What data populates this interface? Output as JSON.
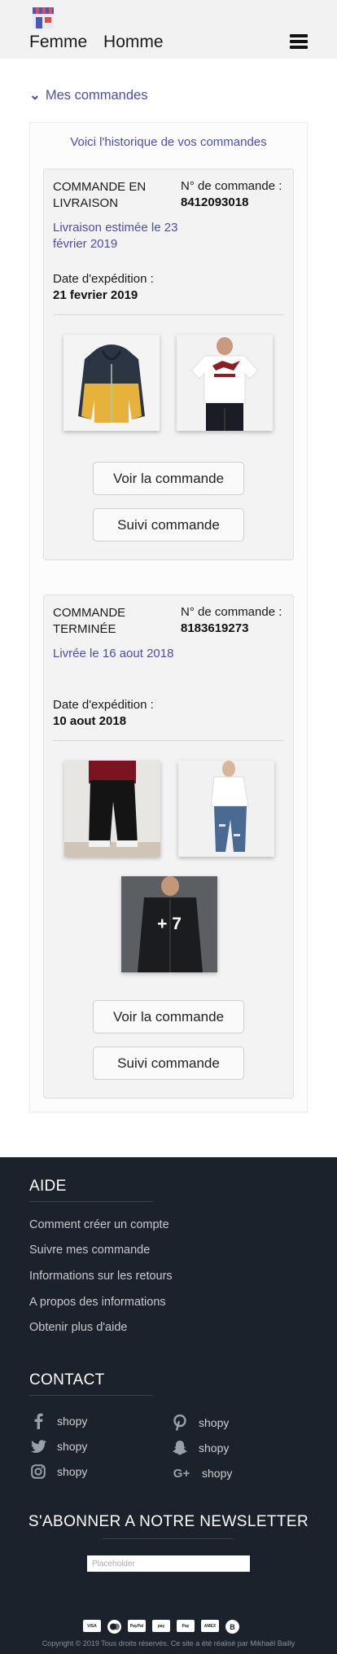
{
  "header": {
    "nav": [
      "Femme",
      "Homme"
    ]
  },
  "section": {
    "label": "Mes commandes"
  },
  "intro": "Voici l'historique de vos commandes",
  "orders": [
    {
      "status": "COMMANDE EN LIVRAISON",
      "number_label": "N° de commande :",
      "number": "8412093018",
      "delivery": "Livraison estimée le 23 février 2019",
      "ship_label": "Date d'expédition :",
      "ship_date": "21 fevrier 2019",
      "items": [
        "hoodie",
        "tee"
      ],
      "view_btn": "Voir la commande",
      "track_btn": "Suivi commande"
    },
    {
      "status": "COMMANDE TERMINÉE",
      "number_label": "N° de commande :",
      "number": "8183619273",
      "delivery": "Livrée le 16 aout 2018",
      "ship_label": "Date d'expédition :",
      "ship_date": "10 aout 2018",
      "items": [
        "joggers",
        "jeans",
        "jacket"
      ],
      "more": "+ 7",
      "view_btn": "Voir la commande",
      "track_btn": "Suivi commande"
    }
  ],
  "footer": {
    "aide_title": "AIDE",
    "aide_links": [
      "Comment créer un compte",
      "Suivre mes commande",
      "Informations sur les retours",
      "A propos des informations",
      "Obtenir plus d'aide"
    ],
    "contact_title": "CONTACT",
    "socials": [
      {
        "icon": "facebook-icon",
        "label": "shopy"
      },
      {
        "icon": "pinterest-icon",
        "label": "shopy"
      },
      {
        "icon": "twitter-icon",
        "label": "shopy"
      },
      {
        "icon": "snapchat-icon",
        "label": "shopy"
      },
      {
        "icon": "instagram-icon",
        "label": "shopy"
      },
      {
        "icon": "google-plus-icon",
        "label": "shopy"
      }
    ],
    "newsletter_title": "S'ABONNER A NOTRE NEWSLETTER",
    "newsletter_placeholder": "Placeholder",
    "payments": [
      "VISA",
      "MC",
      "PayPal",
      "pay",
      "Pay",
      "AMEX",
      "B"
    ],
    "copyright": "Copyright © 2019 Tous droits réservés. Ce site a été réalisé par Mikhaël Bailly"
  },
  "colors": {
    "accent": "#4c4ea3",
    "footer_bg": "#1c222b",
    "header_bg": "#f2f2f2"
  }
}
